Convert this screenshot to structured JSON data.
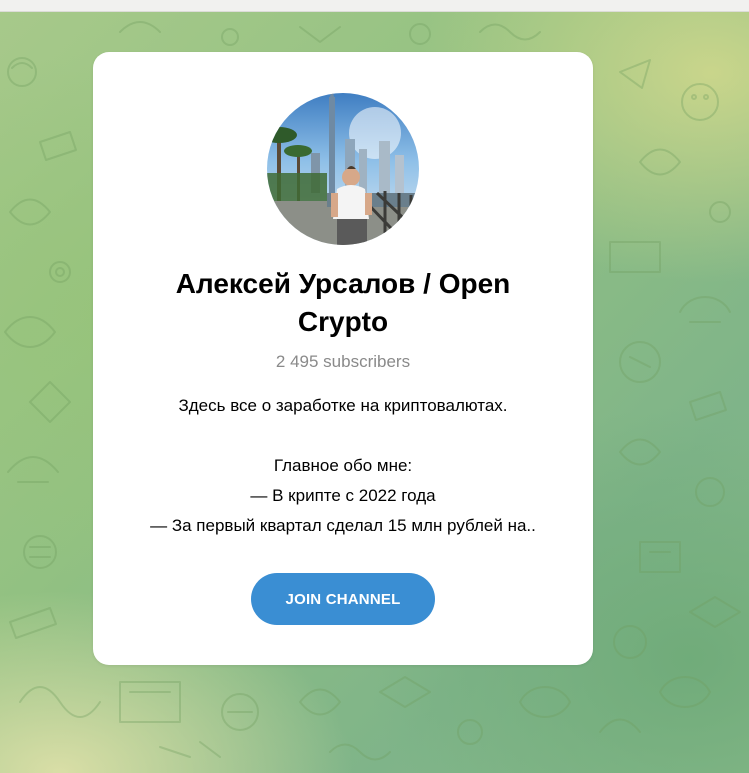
{
  "channel": {
    "title": "Алексей Урсалов / Open Crypto",
    "subscribers": "2 495 subscribers",
    "description": [
      "Здесь все о заработке на криптовалютах.",
      "",
      "Главное обо мне:",
      "— В крипте с 2022 года",
      "— За первый квартал сделал 15 млн рублей на.."
    ],
    "join_label": "JOIN CHANNEL"
  },
  "colors": {
    "accent": "#3a8ed3",
    "card": "#ffffff",
    "subtitle": "#8a8a8a",
    "background_green": "#92c182"
  },
  "icons": {
    "background": "doodle-pattern",
    "avatar": "channel-avatar-photo"
  }
}
